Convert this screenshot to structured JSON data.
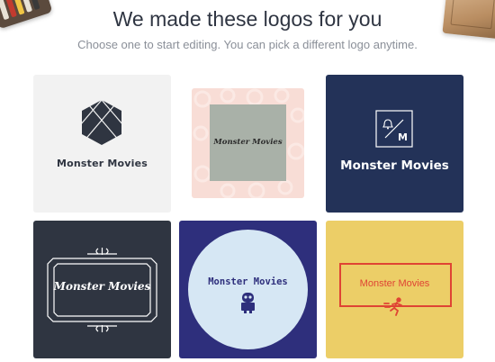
{
  "header": {
    "title": "We made these logos for you",
    "subtitle": "Choose one to start editing. You can pick a different logo anytime."
  },
  "logos": [
    {
      "name": "Monster Movies",
      "style": "hexagon-emblem",
      "colors": {
        "bg": "#f2f2f2",
        "fg": "#2f3541"
      }
    },
    {
      "name": "Monster Movies",
      "style": "floral-pattern",
      "colors": {
        "bg": "#f8ddd6",
        "fg": "#a9b1a8"
      }
    },
    {
      "name": "Monster Movies",
      "style": "monogram-box",
      "colors": {
        "bg": "#233258",
        "fg": "#ffffff"
      }
    },
    {
      "name": "Monster Movies",
      "style": "ornate-frame",
      "colors": {
        "bg": "#2f3541",
        "fg": "#ffffff"
      }
    },
    {
      "name": "Monster Movies",
      "style": "robot-circle",
      "colors": {
        "bg": "#2e2f7c",
        "fg": "#d6e7f4"
      }
    },
    {
      "name": "Monster Movies",
      "style": "runner-frame",
      "colors": {
        "bg": "#ecce67",
        "fg": "#df4434"
      }
    }
  ],
  "monogram": {
    "letter": "M"
  },
  "icons": {
    "card1": "hexagon-icon",
    "card3": "bell-icon",
    "card5": "robot-icon",
    "card6": "running-person-icon"
  }
}
